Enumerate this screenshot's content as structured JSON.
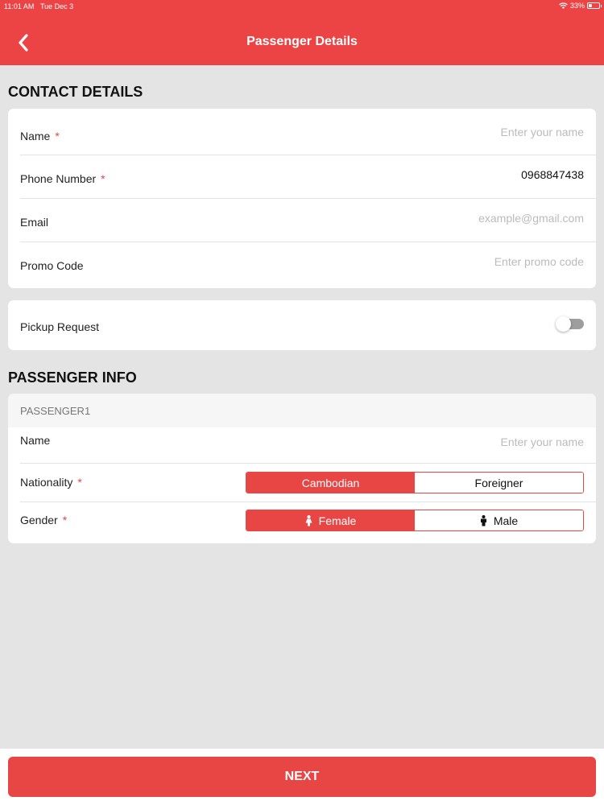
{
  "status_bar": {
    "time": "11:01 AM",
    "date": "Tue Dec 3",
    "battery": "33%",
    "battery_level": 0.33
  },
  "header": {
    "title": "Passenger Details",
    "back_icon": "chevron-left-icon"
  },
  "contact": {
    "section_title": "CONTACT DETAILS",
    "name": {
      "label": "Name",
      "required": "*",
      "value": "",
      "placeholder": "Enter your name"
    },
    "phone": {
      "label": "Phone Number",
      "required": "*",
      "value": "0968847438",
      "placeholder": ""
    },
    "email": {
      "label": "Email",
      "value": "",
      "placeholder": "example@gmail.com"
    },
    "promo": {
      "label": "Promo Code",
      "value": "",
      "placeholder": "Enter promo code"
    }
  },
  "pickup": {
    "label": "Pickup Request",
    "enabled": false
  },
  "passenger_info": {
    "section_title": "PASSENGER INFO",
    "passengers": [
      {
        "tag": "PASSENGER1",
        "name": {
          "label": "Name",
          "value": "",
          "placeholder": "Enter your name"
        },
        "nationality": {
          "label": "Nationality",
          "required": "*",
          "options": [
            "Cambodian",
            "Foreigner"
          ],
          "selected": "Cambodian"
        },
        "gender": {
          "label": "Gender",
          "required": "*",
          "options": [
            "Female",
            "Male"
          ],
          "icons": [
            "female-icon",
            "male-icon"
          ],
          "selected": "Female"
        }
      }
    ]
  },
  "footer": {
    "next_label": "NEXT"
  },
  "colors": {
    "accent": "#e84545",
    "header": "#ec4444",
    "background": "#e4e4e4",
    "placeholder": "#bbbbbb"
  }
}
